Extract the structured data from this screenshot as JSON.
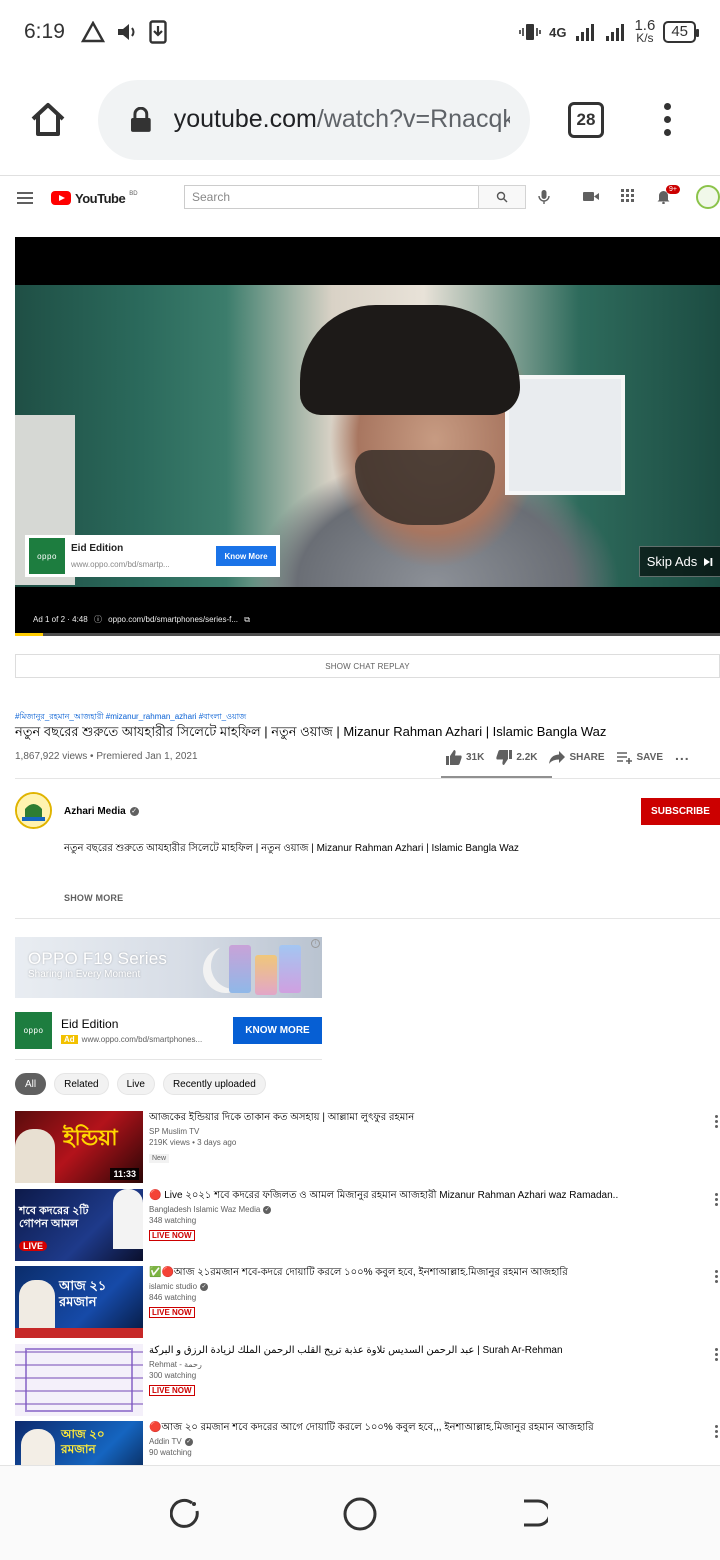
{
  "status_bar": {
    "time": "6:19",
    "network": "4G",
    "speed_value": "1.6",
    "speed_unit": "K/s",
    "battery": "45"
  },
  "browser": {
    "url_domain": "youtube.com",
    "url_path": "/watch?v=Rnacqk",
    "tab_count": "28"
  },
  "youtube_header": {
    "logo": "YouTube",
    "country": "BD",
    "search_placeholder": "Search",
    "notification_count": "9+"
  },
  "player": {
    "ad_title": "Eid Edition",
    "ad_url": "www.oppo.com/bd/smartp...",
    "ad_cta": "Know More",
    "brand": "oppo",
    "skip_label": "Skip Ads",
    "ad_info": "Ad 1 of 2 · 4:48",
    "ad_info_url": "oppo.com/bd/smartphones/series-f...",
    "progress": 0.04
  },
  "show_chat_replay": "SHOW CHAT REPLAY",
  "video": {
    "hashtags": "#মিজানুর_রহমান_আজহারী #mizanur_rahman_azhari #বাংলা_ওয়াজ",
    "title": "নতুন বছরের শুরুতে আযহারীর সিলেটে মাহফিল | নতুন ওয়াজ | Mizanur Rahman Azhari | Islamic Bangla Waz",
    "meta": "1,867,922 views • Premiered Jan 1, 2021",
    "likes": "31K",
    "dislikes": "2.2K",
    "share": "SHARE",
    "save": "SAVE"
  },
  "channel": {
    "name": "Azhari Media",
    "subscribe": "SUBSCRIBE",
    "description": "নতুন বছরের শুরুতে আযহারীর সিলেটে মাহফিল | নতুন ওয়াজ | Mizanur Rahman Azhari | Islamic Bangla Waz",
    "show_more": "SHOW MORE"
  },
  "side_ad": {
    "headline": "OPPO F19 Series",
    "tagline": "Sharing in Every Moment",
    "brand": "oppo",
    "title": "Eid Edition",
    "badge": "Ad",
    "url": "www.oppo.com/bd/smartphones...",
    "cta": "KNOW MORE"
  },
  "chips": [
    "All",
    "Related",
    "Live",
    "Recently uploaded"
  ],
  "recommendations": [
    {
      "title": "আজকের ইন্ডিয়ার দিকে তাকান কত অসহায় | আল্লামা লুৎফুর রহমান",
      "channel": "SP Muslim TV",
      "meta": "219K views • 3 days ago",
      "badge": "New",
      "duration": "11:33",
      "thumb_text": "ইন্ডিয়া"
    },
    {
      "title": "🔴 Live ২০২১ শবে কদরের ফজিলত ও আমল মিজানুর রহমান আজহারী Mizanur Rahman Azhari waz Ramadan..",
      "channel": "Bangladesh Islamic Waz Media",
      "meta": "348 watching",
      "badge": "LIVE NOW",
      "thumb_text": "শবে কদরের ২টি গোপন আমল",
      "thumb_live": "LIVE"
    },
    {
      "title": "✅🔴আজ ২১রমজান শবে-কদরে দোয়াটি করলে ১০০% কবুল হবে, ইনশাআল্লাহ.মিজানুর রহমান আজহারি",
      "channel": "islamic studio",
      "meta": "846 watching",
      "badge": "LIVE NOW",
      "thumb_text": "আজ ২১ রমজান"
    },
    {
      "title": "عبد الرحمن السديس تلاوة عذبة تريح القلب الرحمن الملك لزيادة الرزق و البركة | Surah Ar-Rehman",
      "channel": "Rehmat - رحمة",
      "meta": "300 watching",
      "badge": "LIVE NOW"
    },
    {
      "title": "🔴আজ ২০ রমজান শবে কদরের আগে দোয়াটি করলে ১০০% কবুল হবে,,, ইনশাআল্লাহ.মিজানুর রহমান আজহারি",
      "channel": "Addin TV",
      "meta": "90 watching",
      "thumb_text": "আজ ২০ রমজান"
    }
  ]
}
